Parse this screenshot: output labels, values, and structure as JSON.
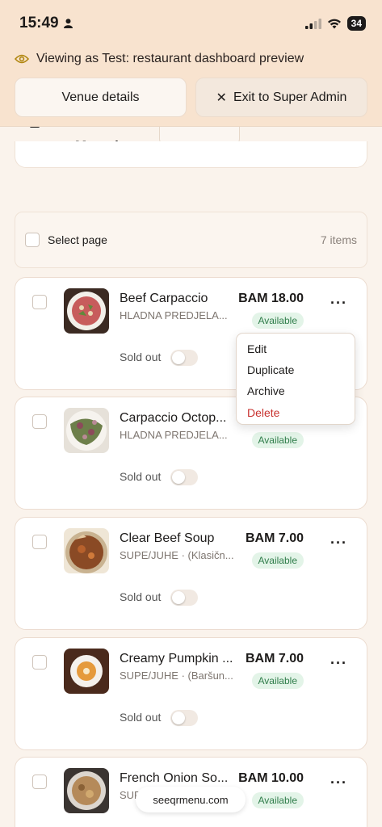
{
  "status_bar": {
    "time": "15:49",
    "battery": "34"
  },
  "banner": {
    "text": "Viewing as Test: restaurant dashboard preview",
    "venue_button": "Venue details",
    "exit_button": "Exit to Super Admin"
  },
  "header": {
    "title": "Menu ite..."
  },
  "select_page": {
    "label": "Select page",
    "count": "7 items"
  },
  "items": [
    {
      "name": "Beef Carpaccio",
      "category": "HLADNA PREDJELA...",
      "price": "BAM 18.00",
      "status": "Available",
      "sold_out_label": "Sold out"
    },
    {
      "name": "Carpaccio Octop...",
      "category": "HLADNA PREDJELA...",
      "price": "",
      "status": "Available",
      "sold_out_label": "Sold out"
    },
    {
      "name": "Clear Beef Soup",
      "category": "SUPE/JUHE · (Klasičn...",
      "price": "BAM 7.00",
      "status": "Available",
      "sold_out_label": "Sold out"
    },
    {
      "name": "Creamy Pumpkin ...",
      "category": "SUPE/JUHE · (Baršun...",
      "price": "BAM 7.00",
      "status": "Available",
      "sold_out_label": "Sold out"
    },
    {
      "name": "French Onion So...",
      "category": "SUP...",
      "price": "BAM 10.00",
      "status": "Available",
      "sold_out_label": ""
    }
  ],
  "context_menu": {
    "edit": "Edit",
    "duplicate": "Duplicate",
    "archive": "Archive",
    "delete": "Delete"
  },
  "footer": {
    "url": "seeqrmenu.com"
  }
}
